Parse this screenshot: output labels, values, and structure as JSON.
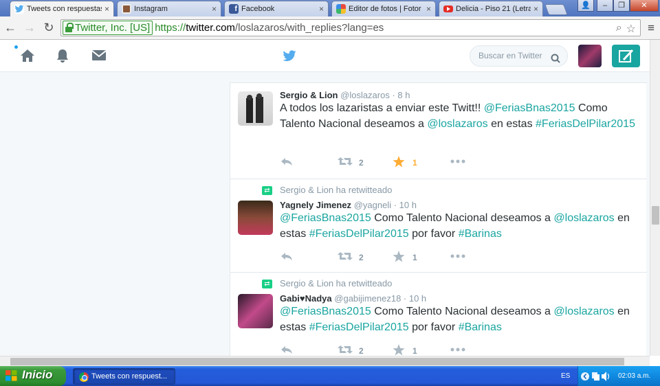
{
  "browser": {
    "tabs": [
      {
        "label": "Tweets con respuestas",
        "close": "×",
        "active": true,
        "icon": "twitter-icon"
      },
      {
        "label": "Instagram",
        "close": "×",
        "active": false,
        "icon": "instagram-icon"
      },
      {
        "label": "Facebook",
        "close": "×",
        "active": false,
        "icon": "facebook-icon"
      },
      {
        "label": "Editor de fotos | Fotor",
        "close": "×",
        "active": false,
        "icon": "fotor-icon"
      },
      {
        "label": "Delicia - Piso 21 (Letra)",
        "close": "×",
        "active": false,
        "icon": "youtube-icon"
      }
    ],
    "window_buttons": {
      "user": "👤",
      "minimize": "–",
      "maximize": "❐",
      "close": "✕"
    },
    "nav": {
      "back": "←",
      "forward": "→",
      "reload": "↻"
    },
    "ev_label": "Twitter, Inc. [US]",
    "url_scheme": "https://",
    "url_host": "twitter.com",
    "url_path": "/loslazaros/with_replies?lang=es",
    "zoom_icon": "⌕",
    "star_icon": "☆",
    "menu_icon": "≡"
  },
  "twitter": {
    "search_placeholder": "Buscar en Twitter",
    "tweets": [
      {
        "name": "Sergio & Lion",
        "handle": "@loslazaros",
        "time": "· 8 h",
        "segments": [
          {
            "t": "A todos los lazaristas a enviar este Twitt!!  ",
            "link": false
          },
          {
            "t": "@FeriasBnas2015",
            "link": true
          },
          {
            "t": " Como Talento Nacional deseamos a ",
            "link": false
          },
          {
            "t": "@loslazaros",
            "link": true
          },
          {
            "t": " en estas ",
            "link": false
          },
          {
            "t": "#FeriasDelPilar2015",
            "link": true
          }
        ],
        "retweets": "2",
        "favorites": "1",
        "favorited": true
      },
      {
        "retweeted_by": "Sergio & Lion ha retwitteado",
        "name": "Yagnely Jimenez",
        "handle": "@yagneli",
        "time": "· 10 h",
        "segments": [
          {
            "t": "@FeriasBnas2015",
            "link": true
          },
          {
            "t": " Como Talento Nacional deseamos a ",
            "link": false
          },
          {
            "t": "@loslazaros",
            "link": true
          },
          {
            "t": " en estas ",
            "link": false
          },
          {
            "t": "#FeriasDelPilar2015",
            "link": true
          },
          {
            "t": " por favor ",
            "link": false
          },
          {
            "t": "#Barinas",
            "link": true
          }
        ],
        "retweets": "2",
        "favorites": "1",
        "favorited": false
      },
      {
        "retweeted_by": "Sergio & Lion ha retwitteado",
        "name": "Gabi♥Nadya",
        "handle": "@gabijimenez18",
        "time": "· 10 h",
        "segments": [
          {
            "t": "@FeriasBnas2015",
            "link": true
          },
          {
            "t": " Como Talento Nacional deseamos a ",
            "link": false
          },
          {
            "t": "@loslazaros",
            "link": true
          },
          {
            "t": " en estas ",
            "link": false
          },
          {
            "t": "#FeriasDelPilar2015",
            "link": true
          },
          {
            "t": " por favor ",
            "link": false
          },
          {
            "t": "#Barinas",
            "link": true
          }
        ],
        "retweets": "2",
        "favorites": "1",
        "favorited": false
      }
    ]
  },
  "taskbar": {
    "start": "Inicio",
    "task": "Tweets con respuest...",
    "lang": "ES",
    "clock": "02:03 a.m."
  },
  "colors": {
    "twitter_blue": "#55acee",
    "link": "#19a5a0",
    "favorite": "#ffac33",
    "retweet_green": "#19cf86"
  }
}
